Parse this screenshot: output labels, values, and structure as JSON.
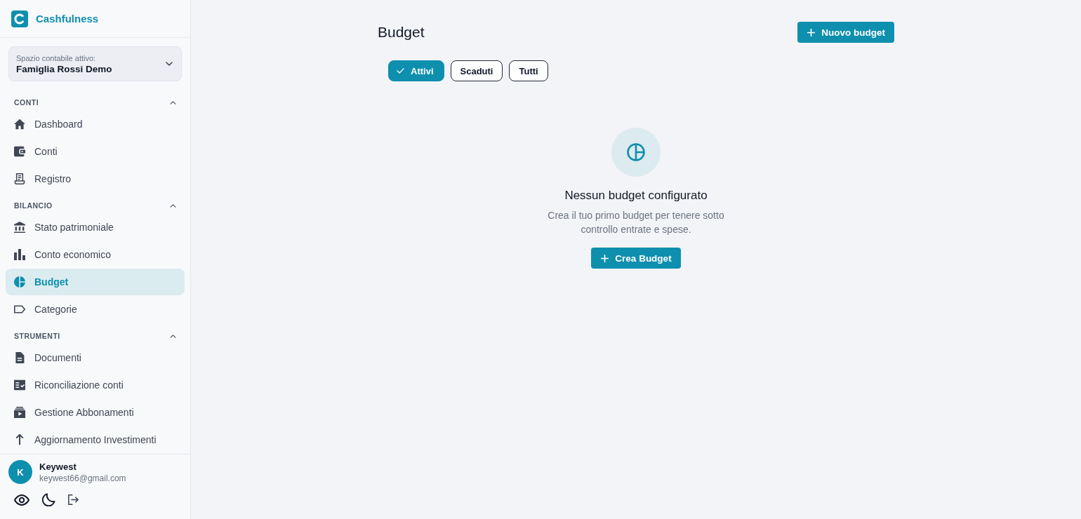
{
  "app": {
    "name": "Cashfulness"
  },
  "workspace": {
    "label": "Spazio contabile attivo:",
    "value": "Famiglia Rossi Demo"
  },
  "sidebar": {
    "sections": [
      {
        "title": "CONTI",
        "expanded": true,
        "items": [
          {
            "label": "Dashboard",
            "selected": false
          },
          {
            "label": "Conti",
            "selected": false
          },
          {
            "label": "Registro",
            "selected": false
          }
        ]
      },
      {
        "title": "BILANCIO",
        "expanded": true,
        "items": [
          {
            "label": "Stato patrimoniale",
            "selected": false
          },
          {
            "label": "Conto economico",
            "selected": false
          },
          {
            "label": "Budget",
            "selected": true
          },
          {
            "label": "Categorie",
            "selected": false
          }
        ]
      },
      {
        "title": "STRUMENTI",
        "expanded": true,
        "items": [
          {
            "label": "Documenti",
            "selected": false
          },
          {
            "label": "Riconciliazione conti",
            "selected": false
          },
          {
            "label": "Gestione Abbonamenti",
            "selected": false
          },
          {
            "label": "Aggiornamento Investimenti",
            "selected": false
          }
        ]
      }
    ]
  },
  "user": {
    "initial": "K",
    "name": "Keywest",
    "email": "keywest66@gmail.com"
  },
  "page": {
    "title": "Budget",
    "new_button": "Nuovo budget",
    "filters": [
      {
        "label": "Attivi",
        "selected": true
      },
      {
        "label": "Scaduti",
        "selected": false
      },
      {
        "label": "Tutti",
        "selected": false
      }
    ]
  },
  "empty_state": {
    "title": "Nessun budget configurato",
    "description": "Crea il tuo primo budget per tenere sotto controllo entrate e spese.",
    "button": "Crea Budget"
  }
}
